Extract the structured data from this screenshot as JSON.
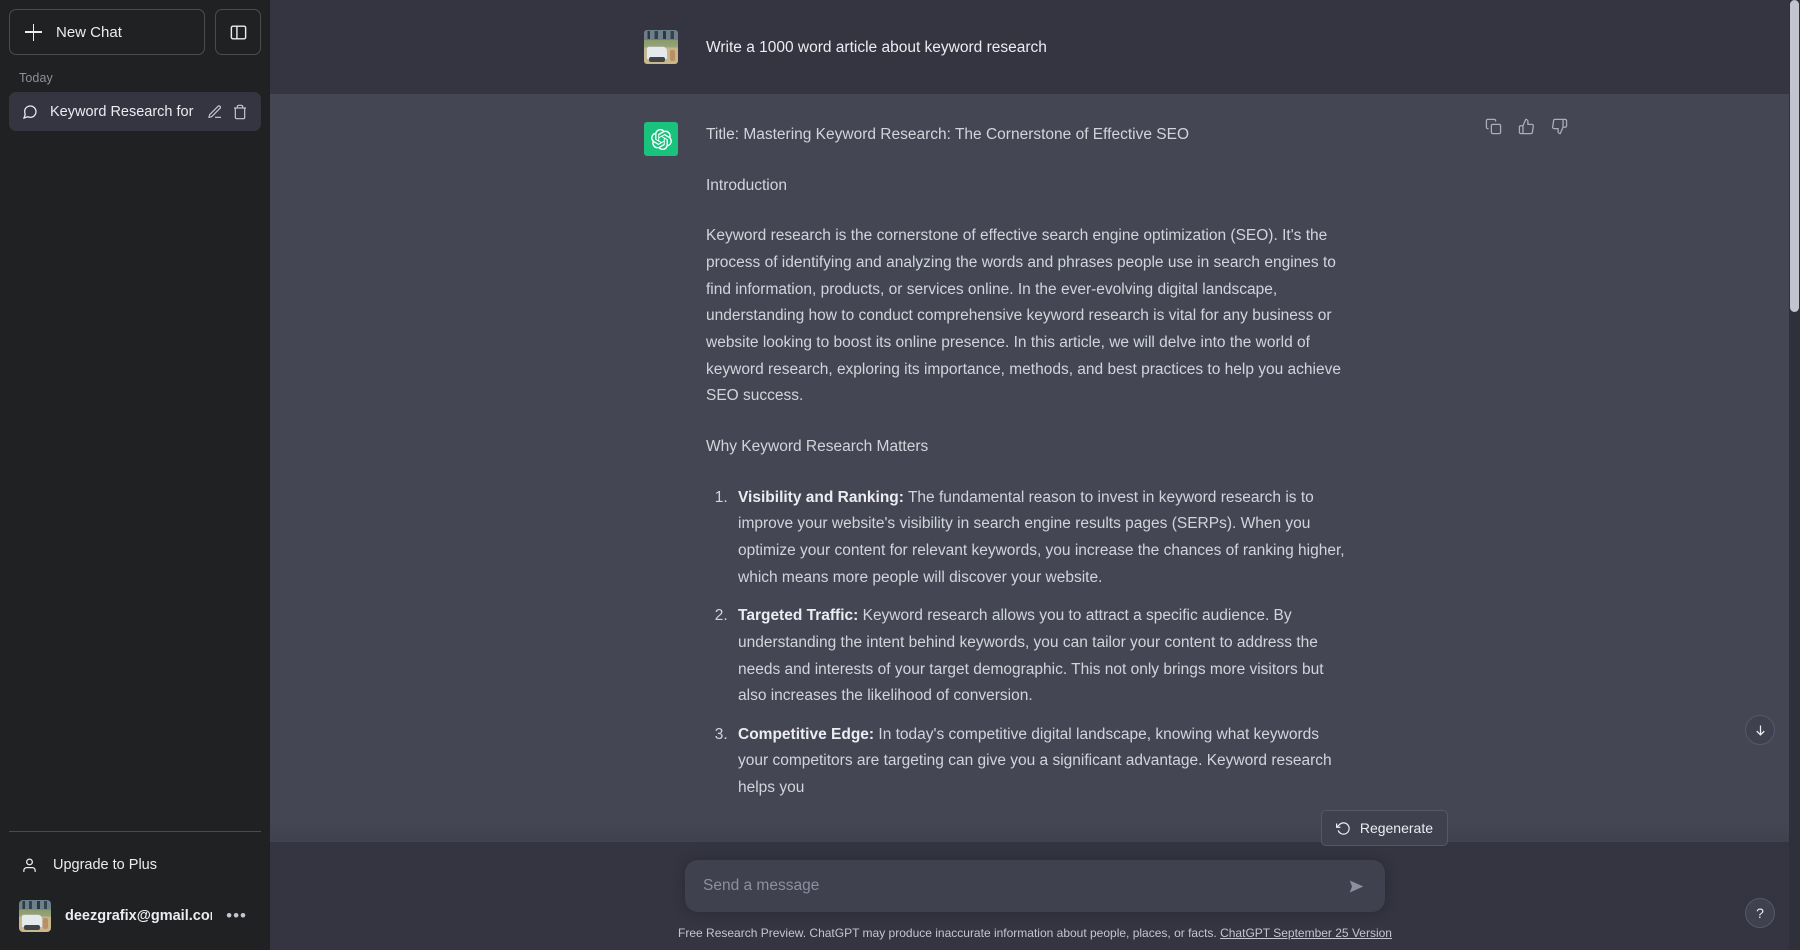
{
  "sidebar": {
    "new_chat_label": "New Chat",
    "new_chat_icon": "plus-icon",
    "toggle_icon": "sidebar-panel-icon",
    "section_label": "Today",
    "chats": [
      {
        "title": "Keyword Research for S",
        "icon": "message-bubble-icon",
        "edit_icon": "pencil-icon",
        "delete_icon": "trash-icon"
      }
    ],
    "upgrade_label": "Upgrade to Plus",
    "upgrade_icon": "person-icon",
    "account_email": "deezgrafix@gmail.com",
    "account_avatar": "user-photo-avatar",
    "account_menu_icon": "ellipsis-icon"
  },
  "conversation": {
    "user_message": {
      "avatar": "user-photo-avatar",
      "text": "Write a 1000 word article about keyword research"
    },
    "assistant_message": {
      "avatar": "chatgpt-logo",
      "title": "Title: Mastering Keyword Research: The Cornerstone of Effective SEO",
      "heading_intro": "Introduction",
      "paragraph_intro": "Keyword research is the cornerstone of effective search engine optimization (SEO). It's the process of identifying and analyzing the words and phrases people use in search engines to find information, products, or services online. In the ever-evolving digital landscape, understanding how to conduct comprehensive keyword research is vital for any business or website looking to boost its online presence. In this article, we will delve into the world of keyword research, exploring its importance, methods, and best practices to help you achieve SEO success.",
      "heading_why": "Why Keyword Research Matters",
      "list_items": [
        {
          "term": "Visibility and Ranking:",
          "body": " The fundamental reason to invest in keyword research is to improve your website's visibility in search engine results pages (SERPs). When you optimize your content for relevant keywords, you increase the chances of ranking higher, which means more people will discover your website."
        },
        {
          "term": "Targeted Traffic:",
          "body": " Keyword research allows you to attract a specific audience. By understanding the intent behind keywords, you can tailor your content to address the needs and interests of your target demographic. This not only brings more visitors but also increases the likelihood of conversion."
        },
        {
          "term": "Competitive Edge:",
          "body": " In today's competitive digital landscape, knowing what keywords your competitors are targeting can give you a significant advantage. Keyword research helps you"
        }
      ],
      "actions": {
        "copy_icon": "copy-icon",
        "thumbs_up_icon": "thumbs-up-icon",
        "thumbs_down_icon": "thumbs-down-icon"
      }
    }
  },
  "composer": {
    "regenerate_label": "Regenerate",
    "regenerate_icon": "refresh-icon",
    "placeholder": "Send a message",
    "input_value": "",
    "send_icon": "send-arrow-icon"
  },
  "footer": {
    "disclaimer": "Free Research Preview. ChatGPT may produce inaccurate information about people, places, or facts.",
    "version_link": "ChatGPT September 25 Version"
  },
  "floating_buttons": {
    "scroll_to_bottom_icon": "arrow-down-icon",
    "help_label": "?"
  },
  "colors": {
    "sidebar_bg": "#202123",
    "user_msg_bg": "#343541",
    "assistant_msg_bg": "#444654",
    "brand_green": "#19c37d",
    "composer_bg": "#40414f",
    "text_primary": "#ececf1",
    "text_secondary": "#c5c5d2",
    "text_muted": "#8e8ea0"
  }
}
